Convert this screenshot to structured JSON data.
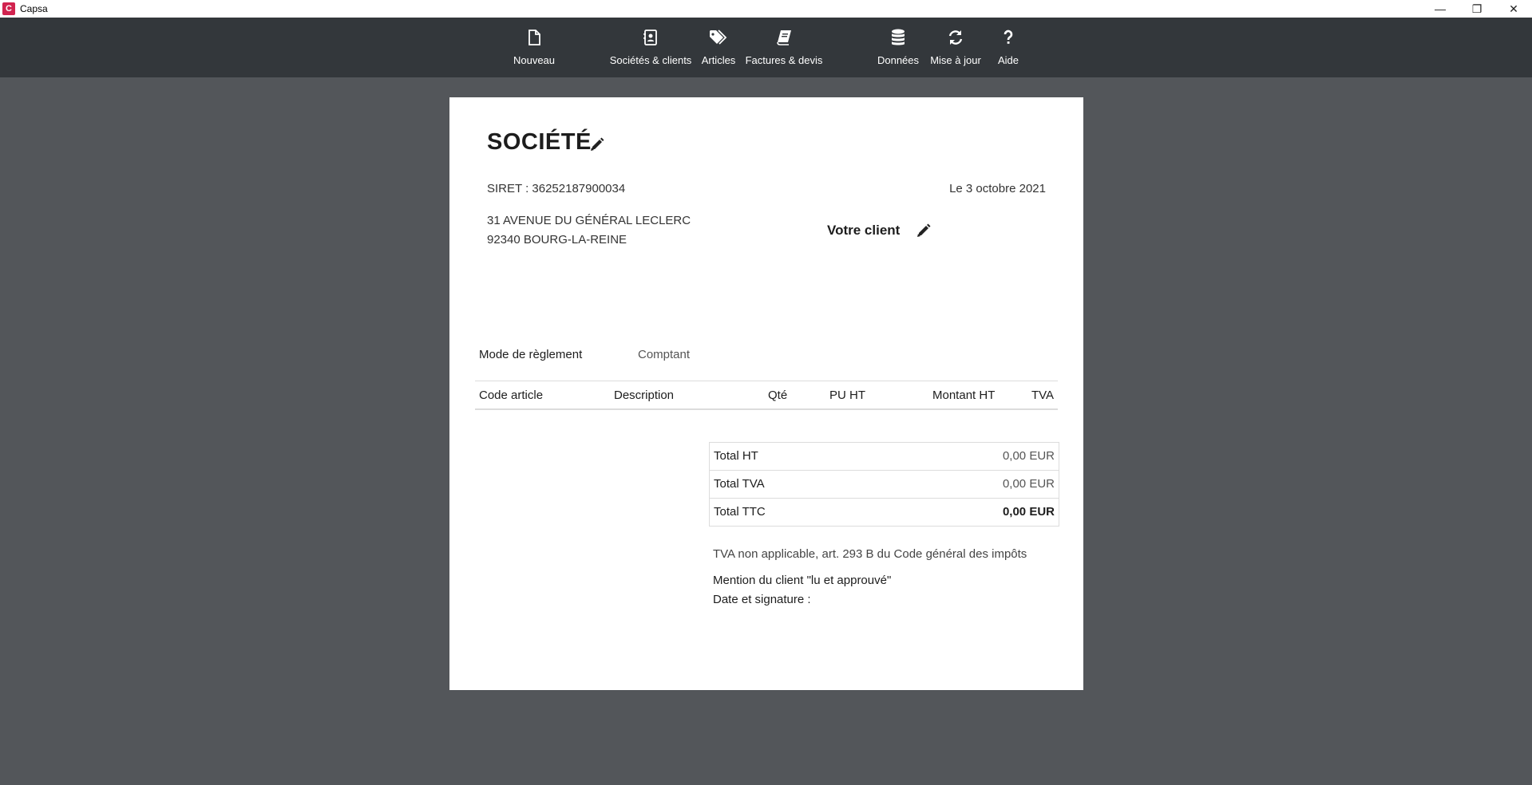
{
  "window": {
    "title": "Capsa",
    "app_icon_letter": "C",
    "minimize": "—",
    "restore": "❐",
    "close": "✕"
  },
  "toolbar": {
    "items": [
      {
        "label": "Nouveau",
        "icon": "file-icon"
      },
      {
        "label": "Sociétés & clients",
        "icon": "address-book-icon"
      },
      {
        "label": "Articles",
        "icon": "tags-icon"
      },
      {
        "label": "Factures & devis",
        "icon": "book-icon"
      },
      {
        "label": "Données",
        "icon": "database-icon"
      },
      {
        "label": "Mise à jour",
        "icon": "refresh-icon"
      },
      {
        "label": "Aide",
        "icon": "question-icon"
      }
    ]
  },
  "document": {
    "company_name": "SOCIÉTÉ",
    "siret": "SIRET : 36252187900034",
    "date": "Le 3 octobre 2021",
    "address_line1": "31 AVENUE DU GÉNÉRAL LECLERC",
    "address_line2": "92340 BOURG-LA-REINE",
    "client_label": "Votre client",
    "payment_label": "Mode de règlement",
    "payment_value": "Comptant",
    "table_headers": [
      "Code article",
      "Description",
      "Qté",
      "PU HT",
      "Montant HT",
      "TVA"
    ],
    "totals": [
      {
        "label": "Total HT",
        "value": "0,00 EUR"
      },
      {
        "label": "Total TVA",
        "value": "0,00 EUR"
      },
      {
        "label": "Total TTC",
        "value": "0,00 EUR"
      }
    ],
    "vat_note": "TVA non applicable, art. 293 B du Code général des impôts",
    "mention_line1": "Mention du client \"lu et approuvé\"",
    "mention_line2": "Date et signature :"
  },
  "colors": {
    "toolbar_bg": "#33373b",
    "workspace_bg": "#53565a",
    "brand": "#d1234f"
  }
}
